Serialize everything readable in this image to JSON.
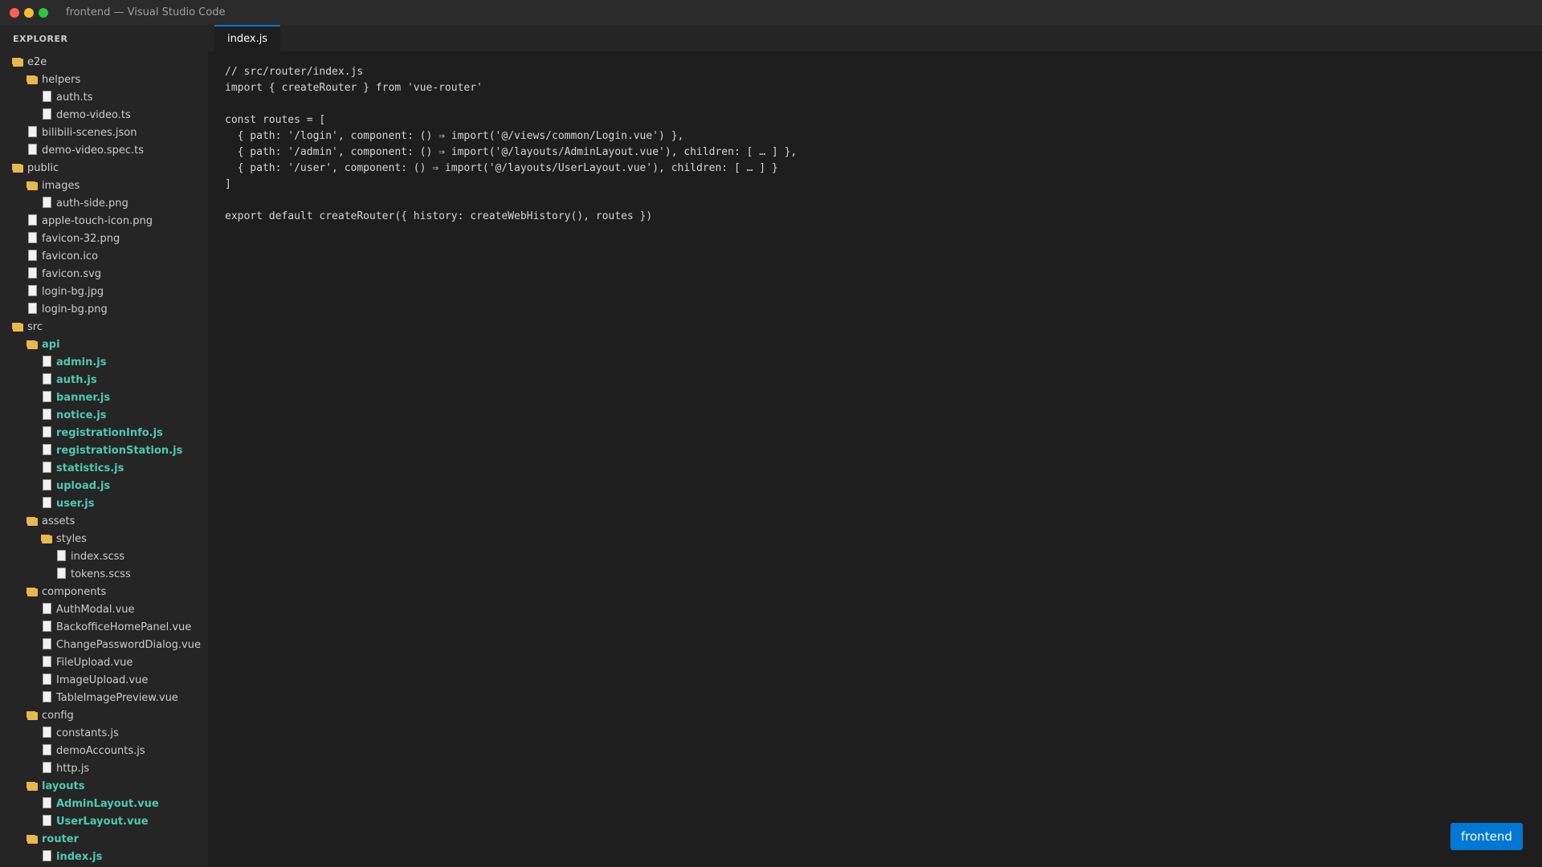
{
  "window": {
    "title": "frontend — Visual Studio Code",
    "traffic_lights": {
      "close": "#ff5f57",
      "minimize": "#febc2e",
      "maximize": "#28c840"
    }
  },
  "sidebar": {
    "header": "EXPLORER",
    "tree": [
      {
        "label": "e2e",
        "type": "folder",
        "depth": 0,
        "highlight": false
      },
      {
        "label": "helpers",
        "type": "folder",
        "depth": 1,
        "highlight": false
      },
      {
        "label": "auth.ts",
        "type": "file",
        "depth": 2,
        "highlight": false
      },
      {
        "label": "demo-video.ts",
        "type": "file",
        "depth": 2,
        "highlight": false
      },
      {
        "label": "bilibili-scenes.json",
        "type": "file",
        "depth": 1,
        "highlight": false
      },
      {
        "label": "demo-video.spec.ts",
        "type": "file",
        "depth": 1,
        "highlight": false
      },
      {
        "label": "public",
        "type": "folder",
        "depth": 0,
        "highlight": false
      },
      {
        "label": "images",
        "type": "folder",
        "depth": 1,
        "highlight": false
      },
      {
        "label": "auth-side.png",
        "type": "file",
        "depth": 2,
        "highlight": false
      },
      {
        "label": "apple-touch-icon.png",
        "type": "file",
        "depth": 1,
        "highlight": false
      },
      {
        "label": "favicon-32.png",
        "type": "file",
        "depth": 1,
        "highlight": false
      },
      {
        "label": "favicon.ico",
        "type": "file",
        "depth": 1,
        "highlight": false
      },
      {
        "label": "favicon.svg",
        "type": "file",
        "depth": 1,
        "highlight": false
      },
      {
        "label": "login-bg.jpg",
        "type": "file",
        "depth": 1,
        "highlight": false
      },
      {
        "label": "login-bg.png",
        "type": "file",
        "depth": 1,
        "highlight": false
      },
      {
        "label": "src",
        "type": "folder",
        "depth": 0,
        "highlight": false
      },
      {
        "label": "api",
        "type": "folder",
        "depth": 1,
        "highlight": true
      },
      {
        "label": "admin.js",
        "type": "file",
        "depth": 2,
        "highlight": true
      },
      {
        "label": "auth.js",
        "type": "file",
        "depth": 2,
        "highlight": true
      },
      {
        "label": "banner.js",
        "type": "file",
        "depth": 2,
        "highlight": true
      },
      {
        "label": "notice.js",
        "type": "file",
        "depth": 2,
        "highlight": true
      },
      {
        "label": "registrationInfo.js",
        "type": "file",
        "depth": 2,
        "highlight": true
      },
      {
        "label": "registrationStation.js",
        "type": "file",
        "depth": 2,
        "highlight": true
      },
      {
        "label": "statistics.js",
        "type": "file",
        "depth": 2,
        "highlight": true
      },
      {
        "label": "upload.js",
        "type": "file",
        "depth": 2,
        "highlight": true
      },
      {
        "label": "user.js",
        "type": "file",
        "depth": 2,
        "highlight": true
      },
      {
        "label": "assets",
        "type": "folder",
        "depth": 1,
        "highlight": false
      },
      {
        "label": "styles",
        "type": "folder",
        "depth": 2,
        "highlight": false
      },
      {
        "label": "index.scss",
        "type": "file",
        "depth": 3,
        "highlight": false
      },
      {
        "label": "tokens.scss",
        "type": "file",
        "depth": 3,
        "highlight": false
      },
      {
        "label": "components",
        "type": "folder",
        "depth": 1,
        "highlight": false
      },
      {
        "label": "AuthModal.vue",
        "type": "file",
        "depth": 2,
        "highlight": false
      },
      {
        "label": "BackofficeHomePanel.vue",
        "type": "file",
        "depth": 2,
        "highlight": false
      },
      {
        "label": "ChangePasswordDialog.vue",
        "type": "file",
        "depth": 2,
        "highlight": false
      },
      {
        "label": "FileUpload.vue",
        "type": "file",
        "depth": 2,
        "highlight": false
      },
      {
        "label": "ImageUpload.vue",
        "type": "file",
        "depth": 2,
        "highlight": false
      },
      {
        "label": "TableImagePreview.vue",
        "type": "file",
        "depth": 2,
        "highlight": false
      },
      {
        "label": "config",
        "type": "folder",
        "depth": 1,
        "highlight": false
      },
      {
        "label": "constants.js",
        "type": "file",
        "depth": 2,
        "highlight": false
      },
      {
        "label": "demoAccounts.js",
        "type": "file",
        "depth": 2,
        "highlight": false
      },
      {
        "label": "http.js",
        "type": "file",
        "depth": 2,
        "highlight": false
      },
      {
        "label": "layouts",
        "type": "folder",
        "depth": 1,
        "highlight": true
      },
      {
        "label": "AdminLayout.vue",
        "type": "file",
        "depth": 2,
        "highlight": true
      },
      {
        "label": "UserLayout.vue",
        "type": "file",
        "depth": 2,
        "highlight": true
      },
      {
        "label": "router",
        "type": "folder",
        "depth": 1,
        "highlight": true
      },
      {
        "label": "index.js",
        "type": "file",
        "depth": 2,
        "highlight": true
      }
    ]
  },
  "editor": {
    "tabs": [
      {
        "label": "index.js",
        "active": true
      }
    ],
    "code_lines": [
      "// src/router/index.js",
      "import { createRouter } from 'vue-router'",
      "",
      "const routes = [",
      "  { path: '/login', component: () ⇒ import('@/views/common/Login.vue') },",
      "  { path: '/admin', component: () ⇒ import('@/layouts/AdminLayout.vue'), children: [ … ] },",
      "  { path: '/user', component: () ⇒ import('@/layouts/UserLayout.vue'), children: [ … ] }",
      "]",
      "",
      "export default createRouter({ history: createWebHistory(), routes })"
    ]
  },
  "badge": {
    "label": "frontend"
  },
  "colors": {
    "accent": "#0078d4",
    "highlight_text": "#4ec9b0",
    "folder": "#e8b84a"
  }
}
